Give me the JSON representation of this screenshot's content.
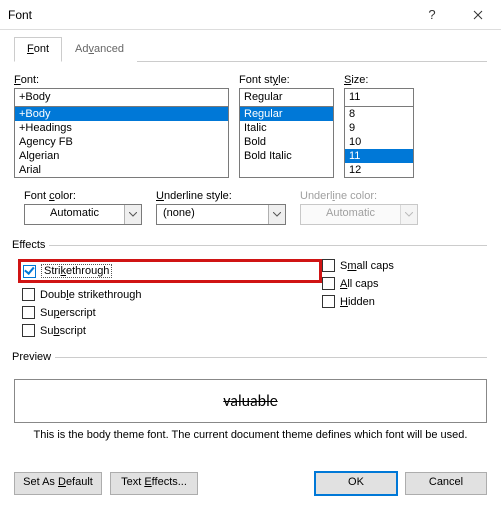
{
  "title": "Font",
  "tabs": {
    "font": "Font",
    "advanced": "Advanced"
  },
  "labels": {
    "font": "Font:",
    "fontStyle": "Font style:",
    "size": "Size:",
    "fontColor": "Font color:",
    "underlineStyle": "Underline style:",
    "underlineColor": "Underline color:",
    "effects": "Effects",
    "preview": "Preview"
  },
  "font": {
    "value": "+Body",
    "options": [
      "+Body",
      "+Headings",
      "Agency FB",
      "Algerian",
      "Arial"
    ],
    "selected": "+Body"
  },
  "fontStyle": {
    "value": "Regular",
    "options": [
      "Regular",
      "Italic",
      "Bold",
      "Bold Italic"
    ],
    "selected": "Regular"
  },
  "size": {
    "value": "11",
    "options": [
      "8",
      "9",
      "10",
      "11",
      "12"
    ],
    "selected": "11"
  },
  "fontColor": "Automatic",
  "underlineStyle": "(none)",
  "underlineColor": "Automatic",
  "effects": {
    "strikethrough": {
      "label": "Strikethrough",
      "checked": true
    },
    "doubleStrikethrough": {
      "label": "Double strikethrough",
      "checked": false
    },
    "superscript": {
      "label": "Superscript",
      "checked": false
    },
    "subscript": {
      "label": "Subscript",
      "checked": false
    },
    "smallCaps": {
      "label": "Small caps",
      "checked": false
    },
    "allCaps": {
      "label": "All caps",
      "checked": false
    },
    "hidden": {
      "label": "Hidden",
      "checked": false
    }
  },
  "previewText": "valuable",
  "hint": "This is the body theme font. The current document theme defines which font will be used.",
  "buttons": {
    "setDefault": "Set As Default",
    "textEffects": "Text Effects...",
    "ok": "OK",
    "cancel": "Cancel"
  }
}
